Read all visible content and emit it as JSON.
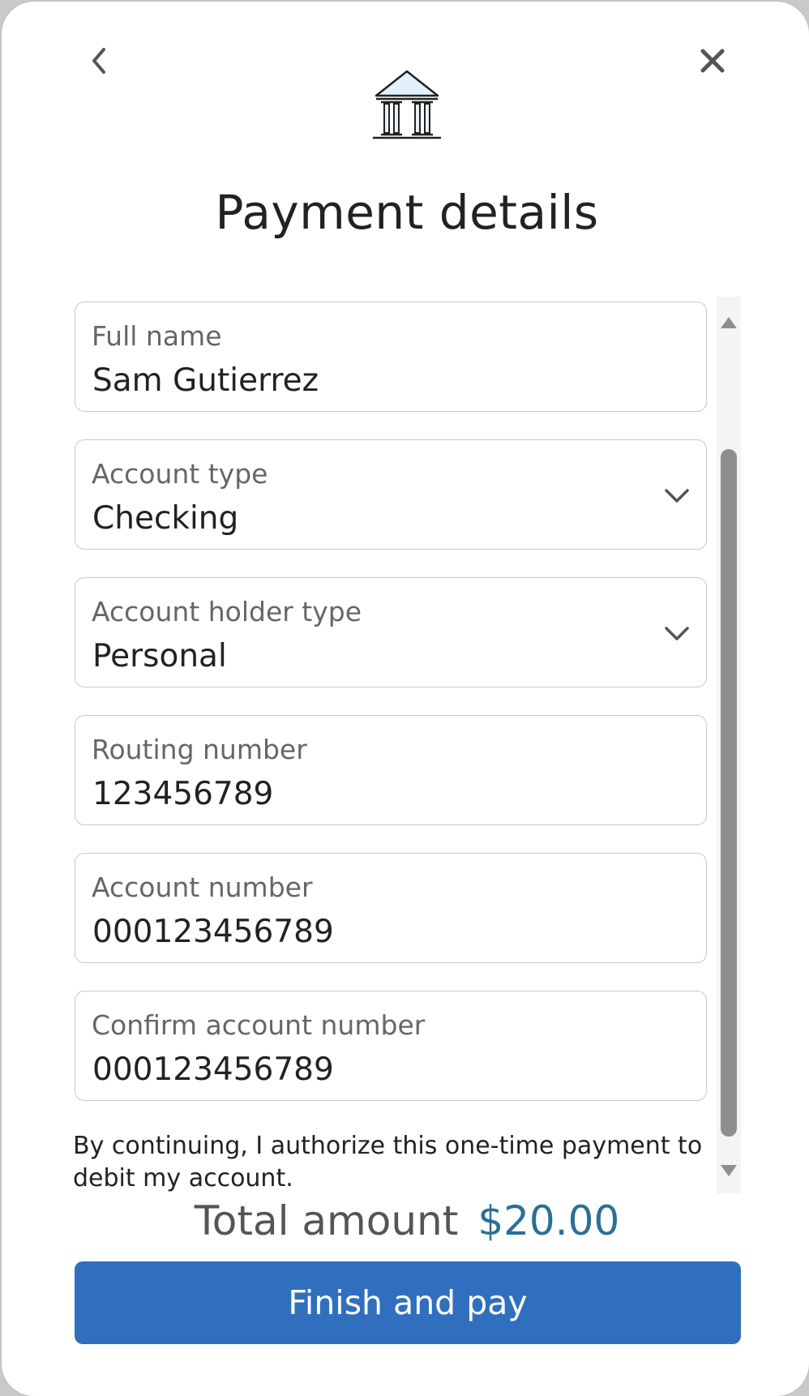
{
  "title": "Payment details",
  "icons": {
    "back": "chevron-left-icon",
    "close": "close-icon",
    "bank": "bank-icon",
    "dropdown": "chevron-down-icon"
  },
  "form": {
    "full_name": {
      "label": "Full name",
      "value": "Sam Gutierrez"
    },
    "account_type": {
      "label": "Account type",
      "value": "Checking"
    },
    "account_holder_type": {
      "label": "Account holder type",
      "value": "Personal"
    },
    "routing_number": {
      "label": "Routing number",
      "value": "123456789"
    },
    "account_number": {
      "label": "Account number",
      "value": "000123456789"
    },
    "confirm_account_number": {
      "label": "Confirm account number",
      "value": "000123456789"
    }
  },
  "authorization_text": "By continuing, I authorize this one-time payment to debit my account.",
  "total": {
    "label": "Total amount",
    "amount": "$20.00"
  },
  "pay_button": "Finish and pay",
  "colors": {
    "primary_button": "#2f6fbd",
    "amount": "#2a6f97"
  }
}
